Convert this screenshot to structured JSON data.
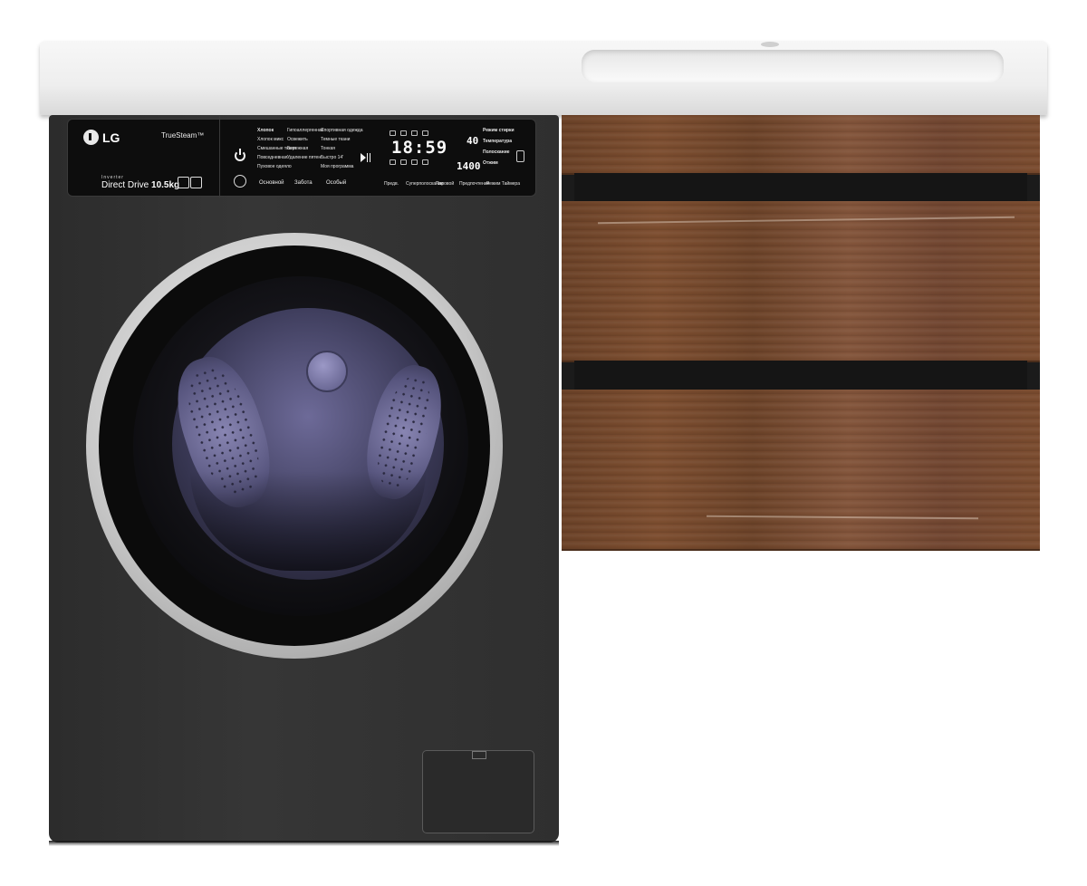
{
  "washer": {
    "brand": "LG",
    "tech_label": "TrueSteam™",
    "inverter_label": "Inverter",
    "direct_drive_label": "Direct Drive",
    "capacity_label": "10.5kg",
    "programs_col1": [
      "Хлопок",
      "Хлопок микс",
      "Смешанные ткани",
      "Повседневная",
      "Пуховое одеяло"
    ],
    "programs_col2": [
      "Гипоаллергенная",
      "Освежить",
      "Бережная",
      "Удаление пятен"
    ],
    "programs_col3": [
      "Спортивная одежда",
      "Темные ткани",
      "Тонкая",
      "Быстро 14'",
      "Моя программа"
    ],
    "program_groups": [
      "Основной",
      "Забота",
      "Особый"
    ],
    "display": {
      "time": "18:59",
      "temperature": "40",
      "spin": "1400"
    },
    "settings": [
      "Режим стирки",
      "Температура",
      "Полоскание",
      "Отжим"
    ],
    "bottom_buttons": [
      "Предв.",
      "Суперполоскание",
      "Паровой",
      "Предпочтения",
      "Режим Таймера"
    ]
  },
  "colors": {
    "washer_body": "#2f2f2f",
    "countertop": "#eeeeee",
    "wood": "#74482c",
    "drum": "#5a5884"
  }
}
